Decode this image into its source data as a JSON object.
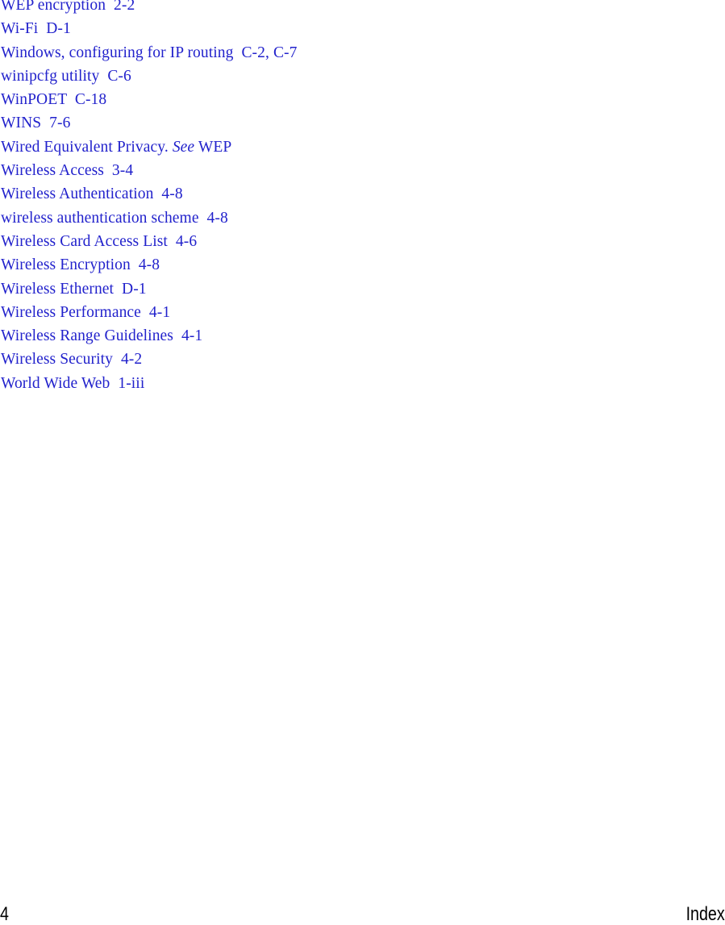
{
  "page": {
    "background_color": "#ffffff",
    "entry_color": "#2222cc",
    "footer_color": "#000000"
  },
  "index": {
    "entries": [
      {
        "text": "WEP encryption  2-2"
      },
      {
        "text": "Wi-Fi  D-1"
      },
      {
        "text": "Windows, configuring for IP routing  C-2, C-7"
      },
      {
        "text": "winipcfg utility  C-6"
      },
      {
        "text": "WinPOET  C-18"
      },
      {
        "text": "WINS  7-6"
      },
      {
        "pre": "Wired Equivalent Privacy. ",
        "italic": "See",
        "post": " WEP"
      },
      {
        "text": "Wireless Access  3-4"
      },
      {
        "text": "Wireless Authentication  4-8"
      },
      {
        "text": "wireless authentication scheme  4-8"
      },
      {
        "text": "Wireless Card Access List  4-6"
      },
      {
        "text": "Wireless Encryption  4-8"
      },
      {
        "text": "Wireless Ethernet  D-1"
      },
      {
        "text": "Wireless Performance  4-1"
      },
      {
        "text": "Wireless Range Guidelines  4-1"
      },
      {
        "text": "Wireless Security  4-2"
      },
      {
        "text": "World Wide Web  1-iii"
      }
    ]
  },
  "footer": {
    "page_number": "4",
    "section_label": "Index"
  }
}
